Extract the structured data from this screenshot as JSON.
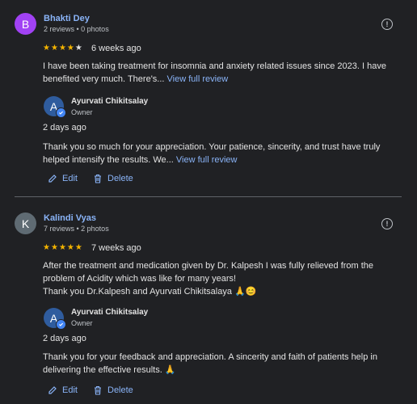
{
  "reviews": [
    {
      "avatar_letter": "B",
      "avatar_color": "#a142f4",
      "name": "Bhakti Dey",
      "meta": "2 reviews • 0 photos",
      "rating": 4,
      "time_ago": "6 weeks ago",
      "text": "I have been taking treatment for insomnia and anxiety related issues since 2023. I have benefited very much. There's...",
      "read_more": "View full review",
      "reply": {
        "owner_letter": "A",
        "owner_name": "Ayurvati Chikitsalay",
        "owner_role": "Owner",
        "time_ago": "2 days ago",
        "text": "Thank you so much for your appreciation. Your patience, sincerity, and trust have truly helped intensify the results. We...",
        "read_more": "View full review"
      },
      "edit_label": "Edit",
      "delete_label": "Delete"
    },
    {
      "avatar_letter": "K",
      "avatar_color": "#5f6b73",
      "name": "Kalindi Vyas",
      "meta": "7 reviews • 2 photos",
      "rating": 5,
      "time_ago": "7 weeks ago",
      "text_lines": [
        "After the treatment and medication given by Dr. Kalpesh I was fully relieved from the problem of Acidity which was like for many years!",
        "Thank you Dr.Kalpesh and Ayurvati Chikitsalaya 🙏😊"
      ],
      "reply": {
        "owner_letter": "A",
        "owner_name": "Ayurvati Chikitsalay",
        "owner_role": "Owner",
        "time_ago": "2 days ago",
        "text": "Thank you for your feedback and appreciation. A sincerity and faith of patients help in delivering the effective results. 🙏"
      },
      "edit_label": "Edit",
      "delete_label": "Delete"
    }
  ],
  "icons": {
    "report": "report-icon",
    "edit": "pencil-icon",
    "delete": "trash-icon",
    "verified": "verified-check-icon",
    "star": "star-icon"
  },
  "colors": {
    "background": "#202124",
    "link": "#8ab4f8",
    "star": "#f4b400",
    "text": "#e3e3e3",
    "secondary": "#bdc1c6"
  }
}
